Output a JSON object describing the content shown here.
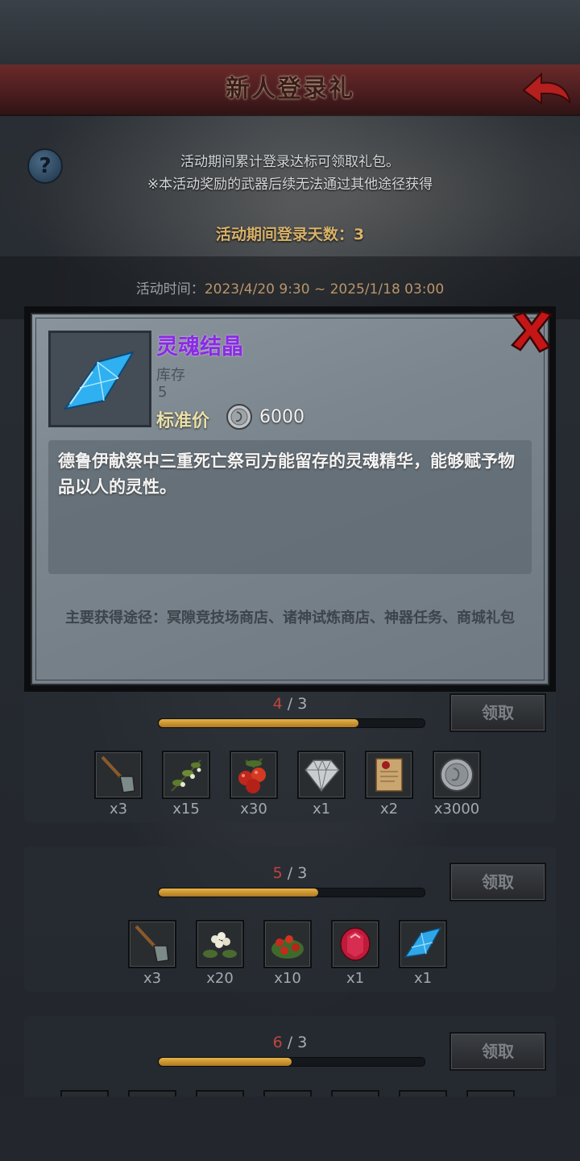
{
  "header": {
    "title": "新人登录礼"
  },
  "info": {
    "line1": "活动期间累计登录达标可领取礼包。",
    "line2": "※本活动奖励的武器后续无法通过其他途径获得",
    "login_days": "活动期间登录天数：3",
    "time_label": "活动时间：",
    "time_value": "2023/4/20 9:30 ~ 2025/1/18 03:00",
    "help_glyph": "?"
  },
  "rows": [
    {
      "current": "4",
      "sep": " / ",
      "target": "3",
      "progress": 0.75,
      "claim": "领取",
      "items": [
        {
          "icon": "shovel-icon",
          "qty": "x3"
        },
        {
          "icon": "herb-sprig-icon",
          "qty": "x15"
        },
        {
          "icon": "red-berries-icon",
          "qty": "x30"
        },
        {
          "icon": "diamond-icon",
          "qty": "x1"
        },
        {
          "icon": "scroll-icon",
          "qty": "x2"
        },
        {
          "icon": "silver-coin-icon",
          "qty": "x3000"
        }
      ]
    },
    {
      "current": "5",
      "sep": " / ",
      "target": "3",
      "progress": 0.6,
      "claim": "领取",
      "items": [
        {
          "icon": "shovel-icon",
          "qty": "x3"
        },
        {
          "icon": "white-flower-icon",
          "qty": "x20"
        },
        {
          "icon": "berry-bush-icon",
          "qty": "x10"
        },
        {
          "icon": "ruby-icon",
          "qty": "x1"
        },
        {
          "icon": "blue-crystal-icon",
          "qty": "x1"
        }
      ]
    },
    {
      "current": "6",
      "sep": " / ",
      "target": "3",
      "progress": 0.5,
      "claim": "领取"
    }
  ],
  "popup": {
    "name": "灵魂结晶",
    "stock_label": "库存",
    "stock_value": "5",
    "price_label": "标准价",
    "price_value": "6000",
    "description": "德鲁伊献祭中三重死亡祭司方能留存的灵魂精华，能够赋予物品以人的灵性。",
    "source": "主要获得途径：冥隙竞技场商店、诸神试炼商店、神器任务、商城礼包",
    "name_color": "#8a2be2"
  }
}
